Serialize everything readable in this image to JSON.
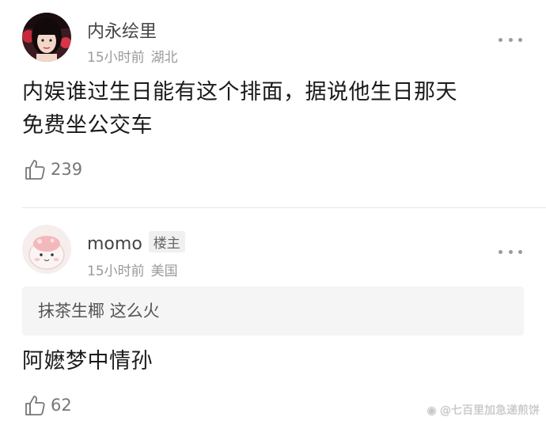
{
  "posts": [
    {
      "username": "内永绘里",
      "time": "15小时前",
      "location": "湖北",
      "content_line1": "内娱谁过生日能有这个排面，据说他生日那天",
      "content_line2": "免费坐公交车",
      "likes": "239"
    },
    {
      "username": "momo",
      "badge": "楼主",
      "time": "15小时前",
      "location": "美国",
      "quote_user": "抹茶生椰",
      "quote_text": "这么火",
      "content": "阿嬷梦中情孙",
      "likes": "62"
    }
  ],
  "watermark": "@七百里加急递煎饼",
  "icons": {
    "more": "more-dots-icon",
    "like": "thumbs-up-icon",
    "watermark_logo": "weibo-logo-icon"
  },
  "colors": {
    "text_primary": "#1a1a1a",
    "text_meta": "#9a9a9a",
    "quote_bg": "#f5f5f5",
    "divider": "#e6e6e6"
  }
}
